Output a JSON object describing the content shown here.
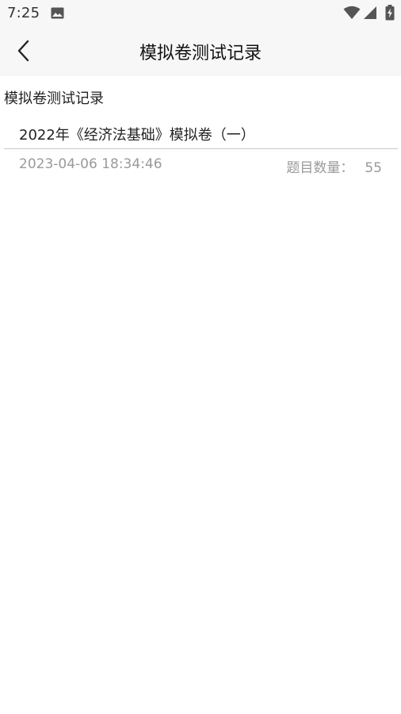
{
  "status_bar": {
    "time": "7:25",
    "icons": [
      "photo-icon",
      "wifi-icon",
      "signal-icon",
      "battery-charging-icon"
    ]
  },
  "header": {
    "title": "模拟卷测试记录",
    "back_icon": "chevron-left-icon"
  },
  "section": {
    "label": "模拟卷测试记录"
  },
  "records": [
    {
      "title": "2022年《经济法基础》模拟卷（一）",
      "date": "2023-04-06 18:34:46",
      "count_label": "题目数量：",
      "count_value": "55"
    }
  ],
  "colors": {
    "bar_background": "#f7f7f7",
    "text_primary": "#222222",
    "text_secondary": "#9a9a9a",
    "divider": "#c8c8c8"
  }
}
